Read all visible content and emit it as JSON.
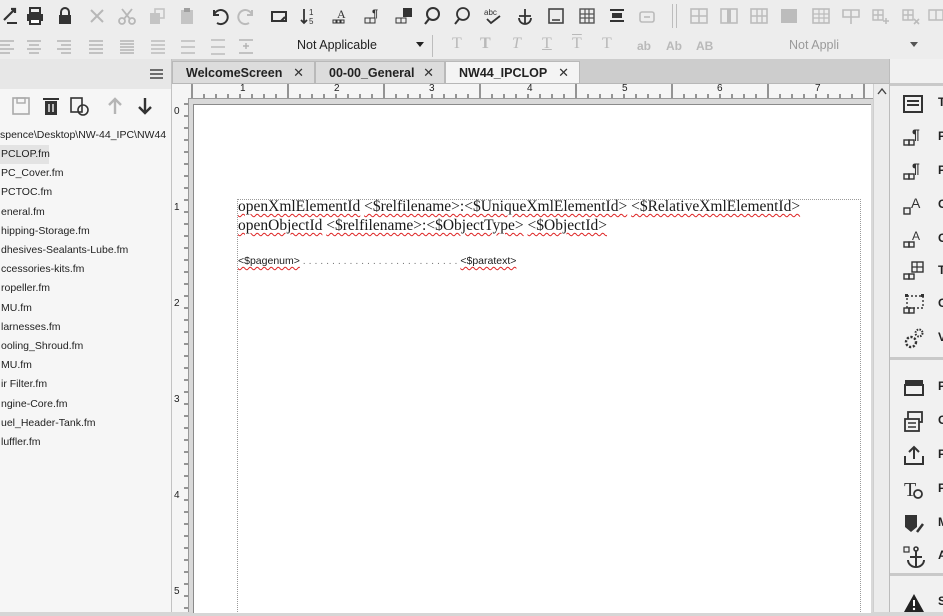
{
  "toolbar2": {
    "para_format_value": "Not Applicable",
    "char_format_value": "Not Appli",
    "format_buttons": [
      "T",
      "T",
      "T",
      "T",
      "T",
      "T",
      "ab",
      "Ab",
      "AB"
    ]
  },
  "left_panel": {
    "path": "spence\\Desktop\\NW-44_IPC\\NW44",
    "files": [
      {
        "label": "PCLOP.fm",
        "selected": true
      },
      {
        "label": "PC_Cover.fm",
        "selected": false
      },
      {
        "label": "PCTOC.fm",
        "selected": false
      },
      {
        "label": "eneral.fm",
        "selected": false
      },
      {
        "label": "hipping-Storage.fm",
        "selected": false
      },
      {
        "label": "dhesives-Sealants-Lube.fm",
        "selected": false
      },
      {
        "label": "ccessories-kits.fm",
        "selected": false
      },
      {
        "label": "ropeller.fm",
        "selected": false
      },
      {
        "label": "MU.fm",
        "selected": false
      },
      {
        "label": "larnesses.fm",
        "selected": false
      },
      {
        "label": "ooling_Shroud.fm",
        "selected": false
      },
      {
        "label": "MU.fm",
        "selected": false
      },
      {
        "label": "ir Filter.fm",
        "selected": false
      },
      {
        "label": "ngine-Core.fm",
        "selected": false
      },
      {
        "label": "uel_Header-Tank.fm",
        "selected": false
      },
      {
        "label": "luffler.fm",
        "selected": false
      }
    ]
  },
  "tabs": [
    {
      "label": "WelcomeScreen",
      "close": "✕",
      "active": false
    },
    {
      "label": "00-00_General",
      "close": "✕",
      "active": false
    },
    {
      "label": "NW44_IPCLOP",
      "close": "✕",
      "active": true
    }
  ],
  "ruler": {
    "h_marks": [
      "1",
      "2",
      "3",
      "4",
      "5",
      "6",
      "7"
    ],
    "v_marks": [
      "0",
      "1",
      "2",
      "3",
      "4",
      "5"
    ]
  },
  "document": {
    "line1": {
      "w1": "openXmlElementId",
      "w2": "<$relfilename>:<$UniqueXmlElementId>",
      "w3": "<$RelativeXmlElementId>"
    },
    "line2": {
      "w1": "openObjectId",
      "w2": "<$relfilename>:<$ObjectType>",
      "w3": "<$ObjectId>"
    },
    "toc": {
      "start": "<$pagenum>",
      "leader": " . . . . . . . . . . . . . . . . . . . . . . . . . . . ",
      "end": "<$paratext>"
    }
  },
  "right_panel": {
    "items": [
      {
        "label": "T",
        "icon": "text-inset-icon"
      },
      {
        "label": "P",
        "icon": "paragraph-catalog-icon"
      },
      {
        "label": "P",
        "icon": "paragraph-designer-icon"
      },
      {
        "label": "C",
        "icon": "character-catalog-icon"
      },
      {
        "label": "C",
        "icon": "character-designer-icon"
      },
      {
        "label": "T",
        "icon": "table-catalog-icon"
      },
      {
        "label": "O",
        "icon": "object-style-icon"
      },
      {
        "label": "V",
        "icon": "variables-icon"
      }
    ],
    "items2": [
      {
        "label": "P",
        "icon": "pages-icon"
      },
      {
        "label": "C",
        "icon": "content-icon"
      },
      {
        "label": "P",
        "icon": "publish-icon"
      },
      {
        "label": "F",
        "icon": "find-icon"
      },
      {
        "label": "M",
        "icon": "markers-icon"
      },
      {
        "label": "A",
        "icon": "anchor-icon"
      }
    ],
    "items3": [
      {
        "label": "S",
        "icon": "warning-icon"
      }
    ]
  },
  "colors": {
    "chrome": "#ededed",
    "panel": "#f6f6f6",
    "page": "#ffffff",
    "spell_error": "#dd2222"
  }
}
